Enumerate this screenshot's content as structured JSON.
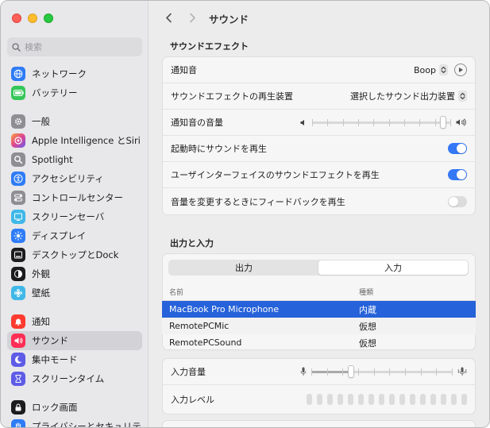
{
  "window": {
    "title": "サウンド"
  },
  "search": {
    "placeholder": "検索"
  },
  "sidebar": {
    "items": [
      {
        "label": "ネットワーク",
        "icon": "globe-icon",
        "color": "#2e7cf6"
      },
      {
        "label": "バッテリー",
        "icon": "battery-icon",
        "color": "#34c759"
      },
      {
        "label": "一般",
        "icon": "gear-icon",
        "color": "#8e8e93"
      },
      {
        "label": "Apple Intelligence とSiri",
        "icon": "siri-icon",
        "color": "#f07b3f"
      },
      {
        "label": "Spotlight",
        "icon": "magnifier-icon",
        "color": "#8e8e93"
      },
      {
        "label": "アクセシビリティ",
        "icon": "accessibility-icon",
        "color": "#2e7cf6"
      },
      {
        "label": "コントロールセンター",
        "icon": "control-center-icon",
        "color": "#8e8e93"
      },
      {
        "label": "スクリーンセーバ",
        "icon": "screensaver-icon",
        "color": "#3fb8e8"
      },
      {
        "label": "ディスプレイ",
        "icon": "sun-icon",
        "color": "#2e7cf6"
      },
      {
        "label": "デスクトップとDock",
        "icon": "dock-icon",
        "color": "#1c1c1e"
      },
      {
        "label": "外観",
        "icon": "appearance-icon",
        "color": "#1c1c1e"
      },
      {
        "label": "壁紙",
        "icon": "wallpaper-icon",
        "color": "#3fb8e8"
      },
      {
        "label": "通知",
        "icon": "bell-icon",
        "color": "#ff3b30"
      },
      {
        "label": "サウンド",
        "icon": "speaker-icon",
        "color": "#ff2d55"
      },
      {
        "label": "集中モード",
        "icon": "moon-icon",
        "color": "#5e5ce6"
      },
      {
        "label": "スクリーンタイム",
        "icon": "hourglass-icon",
        "color": "#5e5ce6"
      },
      {
        "label": "ロック画面",
        "icon": "lock-icon",
        "color": "#1c1c1e"
      },
      {
        "label": "プライバシーとセキュリティ",
        "icon": "hand-icon",
        "color": "#2e7cf6"
      }
    ]
  },
  "sound_effects": {
    "section_title": "サウンドエフェクト",
    "alert_sound_label": "通知音",
    "alert_sound_value": "Boop",
    "output_device_label": "サウンドエフェクトの再生装置",
    "output_device_value": "選択したサウンド出力装置",
    "alert_volume_label": "通知音の音量",
    "alert_volume_level": 0.94,
    "startup_sound_label": "起動時にサウンドを再生",
    "startup_sound_on": true,
    "ui_sound_label": "ユーザインターフェイスのサウンドエフェクトを再生",
    "ui_sound_on": true,
    "feedback_label": "音量を変更するときにフィードバックを再生",
    "feedback_on": false
  },
  "output_input": {
    "section_title": "出力と入力",
    "tabs": [
      "出力",
      "入力"
    ],
    "active_tab": "入力",
    "table": {
      "columns": [
        "名前",
        "種類"
      ],
      "rows": [
        {
          "name": "MacBook Pro Microphone",
          "type": "内蔵",
          "selected": true
        },
        {
          "name": "RemotePCMic",
          "type": "仮想",
          "selected": false
        },
        {
          "name": "RemotePCSound",
          "type": "仮想",
          "selected": false
        }
      ]
    },
    "input_volume_label": "入力音量",
    "input_volume_level": 0.28,
    "input_level_label": "入力レベル",
    "input_level_bars": 16
  },
  "colors": {
    "accent": "#3478f6",
    "selection": "#2662d9"
  }
}
